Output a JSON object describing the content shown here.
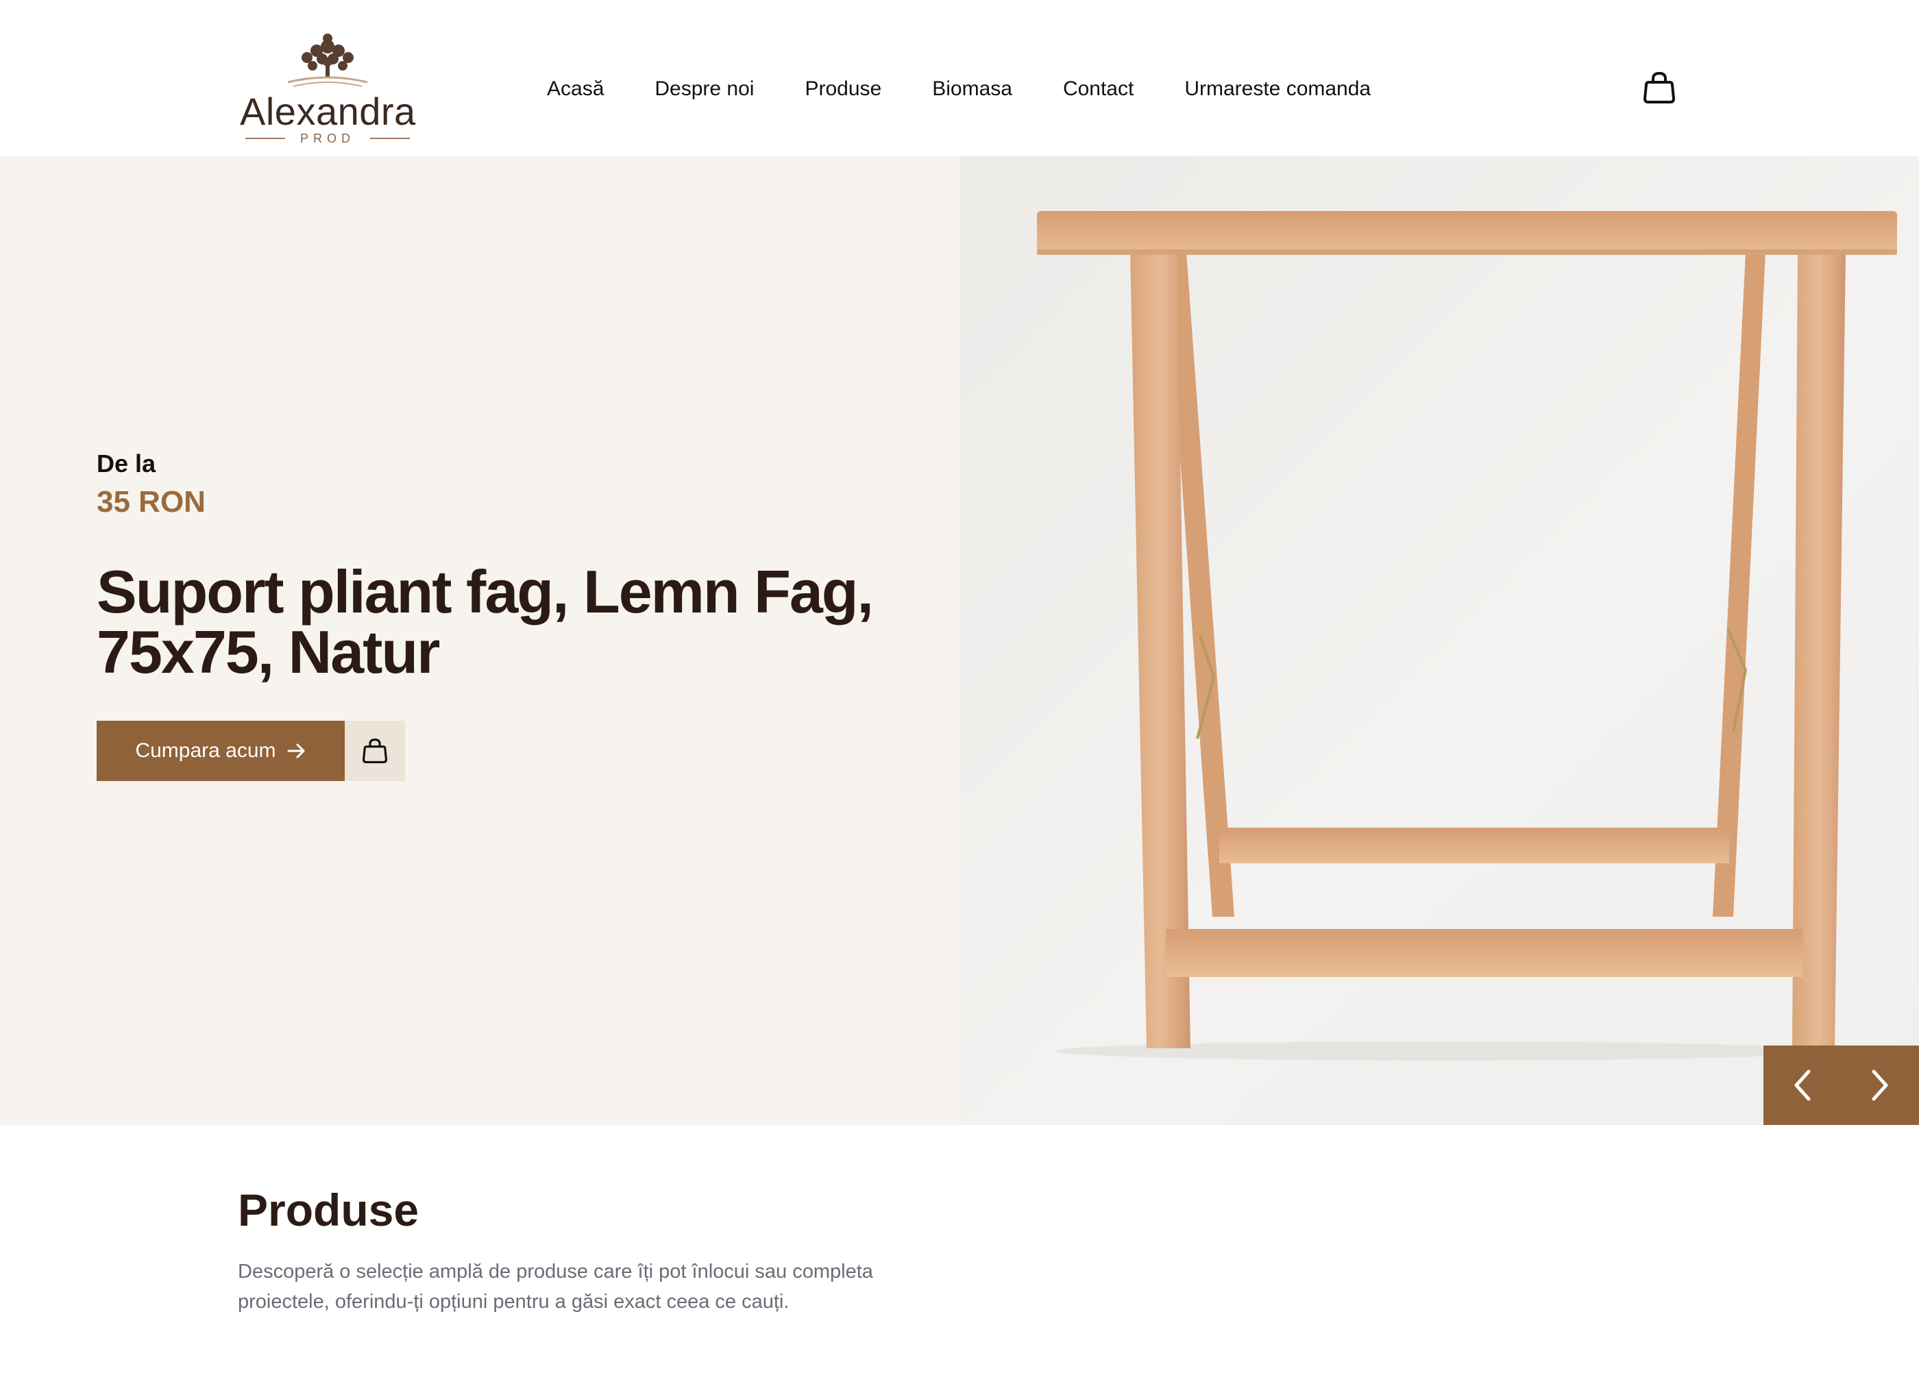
{
  "brand": {
    "name": "Alexandra",
    "sub": "PROD"
  },
  "nav": {
    "items": [
      {
        "label": "Acasă"
      },
      {
        "label": "Despre noi"
      },
      {
        "label": "Produse"
      },
      {
        "label": "Biomasa"
      },
      {
        "label": "Contact"
      },
      {
        "label": "Urmareste comanda"
      }
    ],
    "cart_icon": "shopping-bag-icon"
  },
  "hero": {
    "price_label": "De la",
    "price_value": "35 RON",
    "title": "Suport pliant fag, Lemn Fag, 75x75, Natur",
    "buy_label": "Cumpara acum",
    "buy_icon": "arrow-right-icon",
    "cart_icon": "shopping-bag-icon",
    "image": "beech-wood-folding-trestle",
    "prev_icon": "chevron-left-icon",
    "next_icon": "chevron-right-icon"
  },
  "products": {
    "title": "Produse",
    "description": "Descoperă o selecție amplă de produse care îți pot înlocui sau completa proiectele, oferindu-ți opțiuni pentru a găsi exact ceea ce cauți."
  },
  "colors": {
    "accent": "#8f6239",
    "price": "#9a6a3e",
    "heading": "#2c1b15",
    "hero_bg": "#f7f3ee",
    "cart_btn_bg": "#ece4d8"
  }
}
